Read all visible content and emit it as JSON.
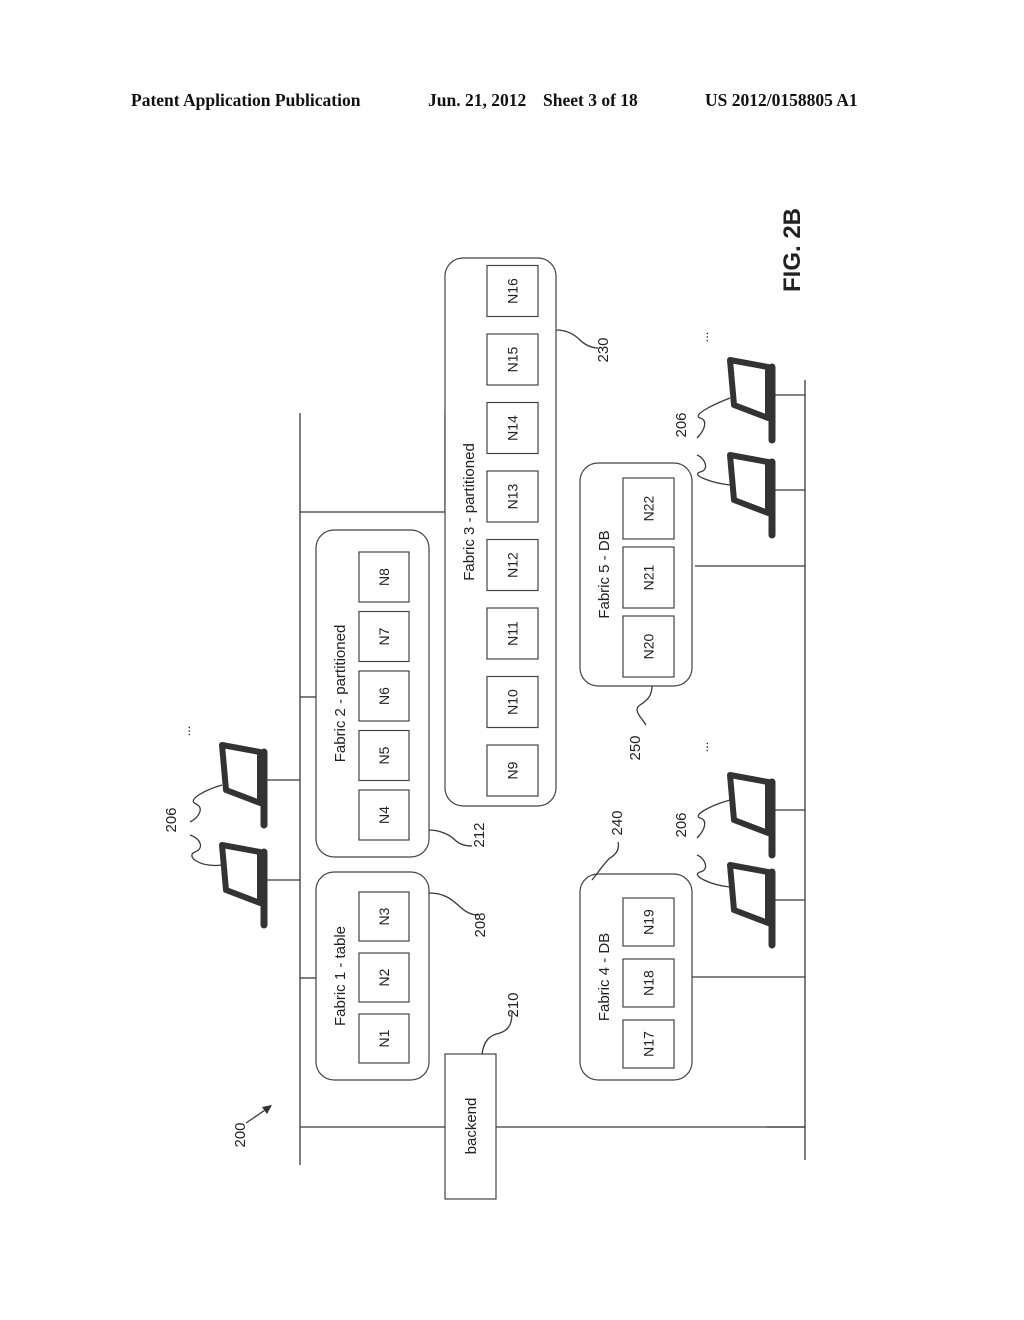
{
  "header": {
    "publication": "Patent Application Publication",
    "date": "Jun. 21, 2012",
    "sheet": "Sheet 3 of 18",
    "number": "US 2012/0158805 A1"
  },
  "figure": {
    "label": "FIG. 2B",
    "system_ref": "200",
    "backend": {
      "label": "backend",
      "ref": "210"
    },
    "client_ref": "206",
    "ellipsis": "...",
    "fabrics": [
      {
        "title": "Fabric 1 - table",
        "ref": "208",
        "nodes": [
          "N1",
          "N2",
          "N3"
        ]
      },
      {
        "title": "Fabric 2 - partitioned",
        "ref": "212",
        "nodes": [
          "N4",
          "N5",
          "N6",
          "N7",
          "N8"
        ]
      },
      {
        "title": "Fabric 3 - partitioned",
        "ref": "230",
        "nodes": [
          "N9",
          "N10",
          "N11",
          "N12",
          "N13",
          "N14",
          "N15",
          "N16"
        ]
      },
      {
        "title": "Fabric 4 - DB",
        "ref": "240",
        "nodes": [
          "N17",
          "N18",
          "N19"
        ]
      },
      {
        "title": "Fabric 5 - DB",
        "ref": "250",
        "nodes": [
          "N20",
          "N21",
          "N22"
        ]
      }
    ]
  }
}
